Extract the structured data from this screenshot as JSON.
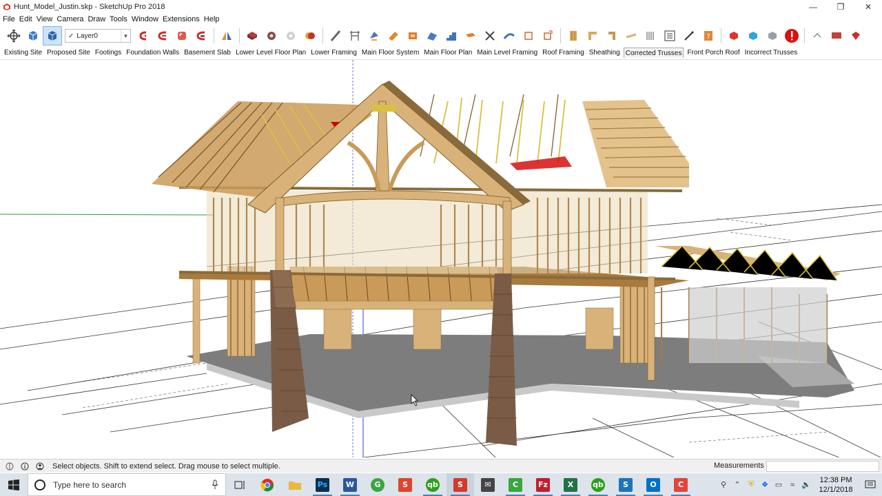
{
  "window": {
    "title": "Hunt_Model_Justin.skp - SketchUp Pro 2018",
    "controls": [
      "minimize-icon",
      "maximize-icon",
      "close-icon"
    ]
  },
  "menu": [
    "File",
    "Edit",
    "View",
    "Camera",
    "Draw",
    "Tools",
    "Window",
    "Extensions",
    "Help"
  ],
  "toolbar": {
    "layer_value": "Layer0",
    "icons": [
      "orbit-icon",
      "iso-view-icon",
      "iso-view-active-icon",
      "push-pull-icon",
      "follow-me-icon",
      "offset-icon",
      "intersect-icon",
      "mirror-icon",
      "component-icon",
      "component-attributes-icon",
      "dynamic-component-icon",
      "solid-tools-icon",
      "line-icon",
      "dimension-icon",
      "section-plane-icon",
      "wall-tool-icon",
      "box-tool-icon",
      "roof-tool-icon",
      "stair-tool-icon",
      "beam-tool-icon",
      "truss-icon",
      "rafter-icon",
      "ruby-console-icon",
      "layout-icon",
      "lumber-icon",
      "framing-icon",
      "bracket-icon",
      "plank-icon",
      "grid-icon",
      "list-icon",
      "pencil-icon",
      "help-icon",
      "extension-warehouse-icon",
      "3d-warehouse-icon",
      "model-info-icon",
      "error-alert-icon",
      "undo-icon",
      "export-icon",
      "ruby-icon"
    ]
  },
  "scenes": {
    "active": "Corrected Trusses",
    "tabs": [
      "Existing Site",
      "Proposed Site",
      "Footings",
      "Foundation Walls",
      "Basement Slab",
      "Lower Level Floor Plan",
      "Lower Framing",
      "Main Floor System",
      "Main Floor Plan",
      "Main Level Framing",
      "Roof Framing",
      "Sheathing",
      "Corrected Trusses",
      "Front Porch Roof",
      "Incorrect Trusses"
    ]
  },
  "status": {
    "message": "Select objects. Shift to extend select. Drag mouse to select multiple.",
    "measurements_label": "Measurements",
    "measurements_value": ""
  },
  "taskbar": {
    "search_placeholder": "Type here to search",
    "time": "12:38 PM",
    "date": "12/1/2018",
    "apps": [
      {
        "name": "chrome",
        "color": "#d93025",
        "glyph": ""
      },
      {
        "name": "file-explorer",
        "color": "#e8b93c",
        "glyph": ""
      },
      {
        "name": "photoshop",
        "color": "#0b2f4e",
        "glyph": "Ps"
      },
      {
        "name": "word",
        "color": "#2b579a",
        "glyph": "W"
      },
      {
        "name": "greenshot",
        "color": "#3aa641",
        "glyph": "G"
      },
      {
        "name": "sketchup-layout",
        "color": "#e0442f",
        "glyph": "S"
      },
      {
        "name": "quickbooks",
        "color": "#2ca01c",
        "glyph": "qb"
      },
      {
        "name": "sketchup",
        "color": "#d23a2d",
        "glyph": "S"
      },
      {
        "name": "mail",
        "color": "#444",
        "glyph": "✉"
      },
      {
        "name": "camtasia",
        "color": "#3aa641",
        "glyph": "C"
      },
      {
        "name": "filezilla",
        "color": "#bf1e2d",
        "glyph": "Fz"
      },
      {
        "name": "excel",
        "color": "#217346",
        "glyph": "X"
      },
      {
        "name": "quickbooks-2",
        "color": "#2ca01c",
        "glyph": "qb"
      },
      {
        "name": "snagit",
        "color": "#1c75bc",
        "glyph": "S"
      },
      {
        "name": "outlook",
        "color": "#0072c6",
        "glyph": "O"
      },
      {
        "name": "camtasia-recorder",
        "color": "#e2443a",
        "glyph": "C"
      }
    ]
  },
  "colors": {
    "lumber": "#d9b27a",
    "lumber_dark": "#a97e43",
    "slab": "#7a7a7a",
    "stone": "#7a5b45",
    "truss_yellow": "#d8c040",
    "red_axis": "#d40000",
    "green_axis": "#2e9a2e",
    "blue_axis": "#2f3fd0"
  }
}
